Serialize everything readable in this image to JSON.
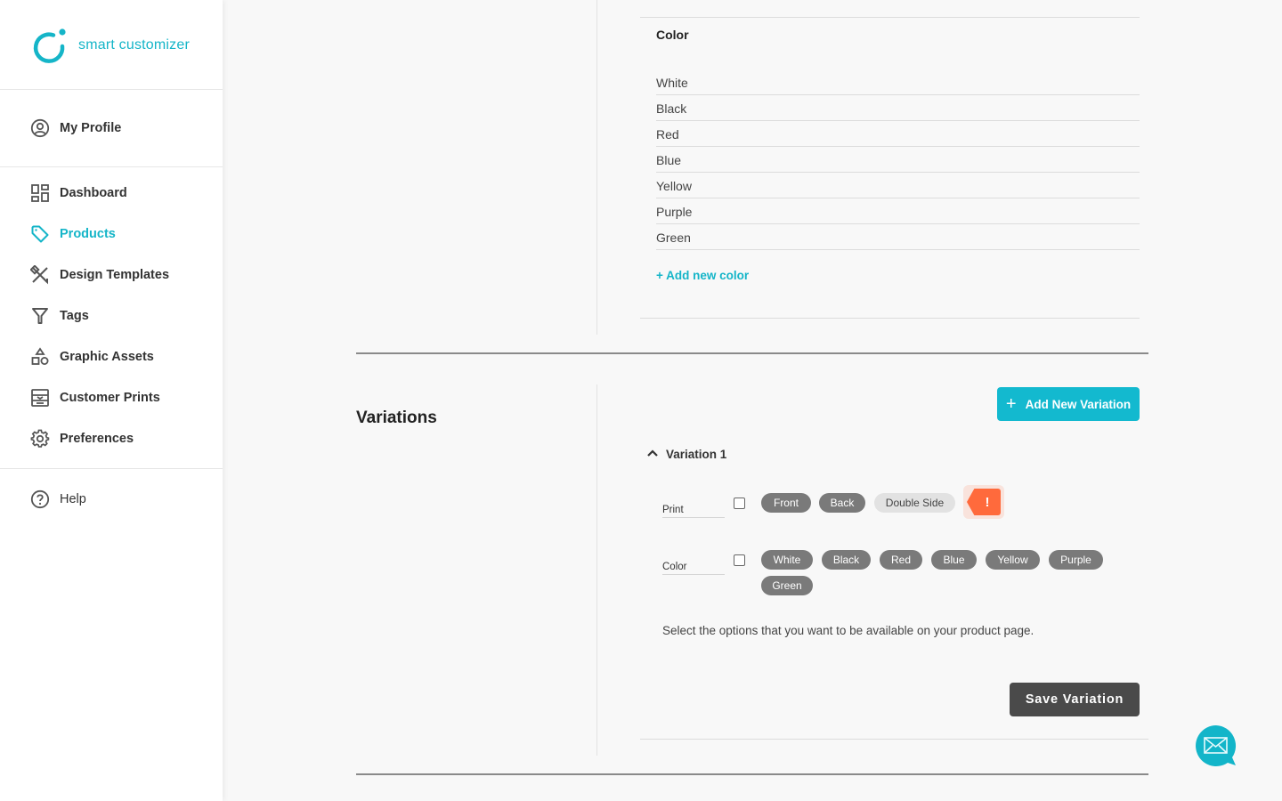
{
  "brand": {
    "name": "smart customizer",
    "accent": "#15b5c8",
    "warning": "#ff6a3c"
  },
  "sidebar": {
    "profile": {
      "label": "My Profile",
      "icon": "user-circle-icon"
    },
    "items": [
      {
        "label": "Dashboard",
        "icon": "dashboard-icon",
        "active": false
      },
      {
        "label": "Products",
        "icon": "tag-icon",
        "active": true
      },
      {
        "label": "Design Templates",
        "icon": "design-tools-icon",
        "active": false
      },
      {
        "label": "Tags",
        "icon": "filter-icon",
        "active": false
      },
      {
        "label": "Graphic Assets",
        "icon": "shapes-icon",
        "active": false
      },
      {
        "label": "Customer Prints",
        "icon": "prints-icon",
        "active": false
      },
      {
        "label": "Preferences",
        "icon": "gear-icon",
        "active": false
      }
    ],
    "help": {
      "label": "Help",
      "icon": "help-circle-icon"
    }
  },
  "color_options": {
    "heading": "Color",
    "values": [
      "White",
      "Black",
      "Red",
      "Blue",
      "Yellow",
      "Purple",
      "Green"
    ],
    "add_link": "+ Add new color"
  },
  "variations": {
    "title": "Variations",
    "add_button": "Add New Variation",
    "add_button_icon": "+",
    "items": [
      {
        "label": "Variation 1",
        "expanded": true,
        "options": [
          {
            "label": "Print",
            "checked": false,
            "chips": [
              {
                "label": "Front",
                "selected": true
              },
              {
                "label": "Back",
                "selected": true
              },
              {
                "label": "Double Side",
                "selected": false
              }
            ],
            "warning": "!"
          },
          {
            "label": "Color",
            "checked": false,
            "chips": [
              {
                "label": "White",
                "selected": true
              },
              {
                "label": "Black",
                "selected": true
              },
              {
                "label": "Red",
                "selected": true
              },
              {
                "label": "Blue",
                "selected": true
              },
              {
                "label": "Yellow",
                "selected": true
              },
              {
                "label": "Purple",
                "selected": true
              },
              {
                "label": "Green",
                "selected": true
              }
            ]
          }
        ],
        "hint": "Select the options that you want to be available on your product page.",
        "save_button": "Save Variation"
      }
    ]
  },
  "chat": {
    "icon": "mail-chat-icon"
  }
}
